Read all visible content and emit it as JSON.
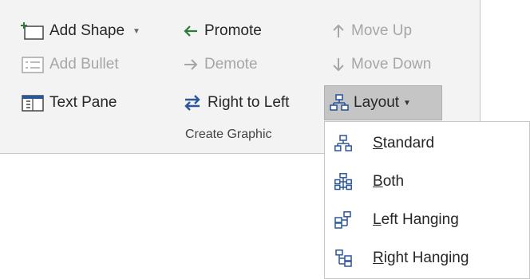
{
  "colors": {
    "accent": "#2b7a3b",
    "icon_blue": "#2b579a",
    "disabled": "#a6a6a6"
  },
  "ribbon": {
    "add_shape": {
      "label": "Add Shape",
      "icon": "add-shape-icon"
    },
    "add_bullet": {
      "label": "Add Bullet",
      "icon": "add-bullet-icon"
    },
    "text_pane": {
      "label": "Text Pane",
      "icon": "text-pane-icon"
    },
    "promote": {
      "label": "Promote",
      "icon": "arrow-left-icon"
    },
    "demote": {
      "label": "Demote",
      "icon": "arrow-right-icon"
    },
    "right_to_left": {
      "label": "Right to Left",
      "icon": "right-to-left-icon"
    },
    "move_up": {
      "label": "Move Up",
      "icon": "arrow-up-icon"
    },
    "move_down": {
      "label": "Move Down",
      "icon": "arrow-down-icon"
    },
    "layout": {
      "label": "Layout",
      "icon": "org-chart-icon"
    },
    "group_label": "Create Graphic"
  },
  "layout_menu": {
    "items": [
      {
        "accel": "S",
        "rest": "tandard",
        "icon": "standard-layout-icon"
      },
      {
        "accel": "B",
        "rest": "oth",
        "icon": "both-layout-icon"
      },
      {
        "accel": "L",
        "rest": "eft Hanging",
        "icon": "left-hanging-icon"
      },
      {
        "accel": "R",
        "rest": "ight Hanging",
        "icon": "right-hanging-icon"
      }
    ]
  }
}
